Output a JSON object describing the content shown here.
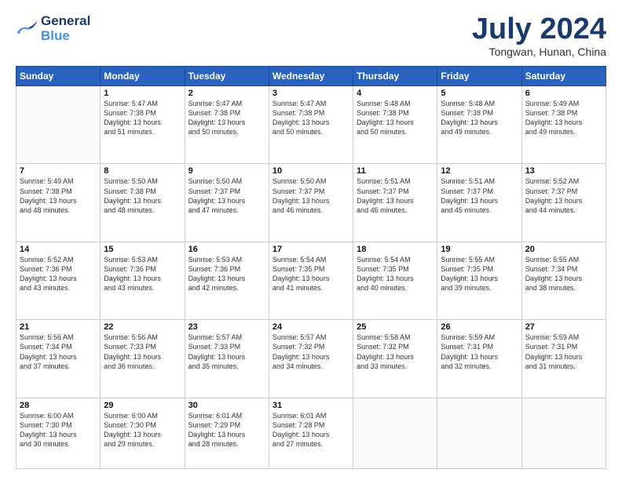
{
  "header": {
    "logo_line1": "General",
    "logo_line2": "Blue",
    "month": "July 2024",
    "location": "Tongwan, Hunan, China"
  },
  "days_of_week": [
    "Sunday",
    "Monday",
    "Tuesday",
    "Wednesday",
    "Thursday",
    "Friday",
    "Saturday"
  ],
  "weeks": [
    [
      {
        "day": "",
        "content": ""
      },
      {
        "day": "1",
        "content": "Sunrise: 5:47 AM\nSunset: 7:38 PM\nDaylight: 13 hours\nand 51 minutes."
      },
      {
        "day": "2",
        "content": "Sunrise: 5:47 AM\nSunset: 7:38 PM\nDaylight: 13 hours\nand 50 minutes."
      },
      {
        "day": "3",
        "content": "Sunrise: 5:47 AM\nSunset: 7:38 PM\nDaylight: 13 hours\nand 50 minutes."
      },
      {
        "day": "4",
        "content": "Sunrise: 5:48 AM\nSunset: 7:38 PM\nDaylight: 13 hours\nand 50 minutes."
      },
      {
        "day": "5",
        "content": "Sunrise: 5:48 AM\nSunset: 7:38 PM\nDaylight: 13 hours\nand 49 minutes."
      },
      {
        "day": "6",
        "content": "Sunrise: 5:49 AM\nSunset: 7:38 PM\nDaylight: 13 hours\nand 49 minutes."
      }
    ],
    [
      {
        "day": "7",
        "content": "Sunrise: 5:49 AM\nSunset: 7:38 PM\nDaylight: 13 hours\nand 48 minutes."
      },
      {
        "day": "8",
        "content": "Sunrise: 5:50 AM\nSunset: 7:38 PM\nDaylight: 13 hours\nand 48 minutes."
      },
      {
        "day": "9",
        "content": "Sunrise: 5:50 AM\nSunset: 7:37 PM\nDaylight: 13 hours\nand 47 minutes."
      },
      {
        "day": "10",
        "content": "Sunrise: 5:50 AM\nSunset: 7:37 PM\nDaylight: 13 hours\nand 46 minutes."
      },
      {
        "day": "11",
        "content": "Sunrise: 5:51 AM\nSunset: 7:37 PM\nDaylight: 13 hours\nand 46 minutes."
      },
      {
        "day": "12",
        "content": "Sunrise: 5:51 AM\nSunset: 7:37 PM\nDaylight: 13 hours\nand 45 minutes."
      },
      {
        "day": "13",
        "content": "Sunrise: 5:52 AM\nSunset: 7:37 PM\nDaylight: 13 hours\nand 44 minutes."
      }
    ],
    [
      {
        "day": "14",
        "content": "Sunrise: 5:52 AM\nSunset: 7:36 PM\nDaylight: 13 hours\nand 43 minutes."
      },
      {
        "day": "15",
        "content": "Sunrise: 5:53 AM\nSunset: 7:36 PM\nDaylight: 13 hours\nand 43 minutes."
      },
      {
        "day": "16",
        "content": "Sunrise: 5:53 AM\nSunset: 7:36 PM\nDaylight: 13 hours\nand 42 minutes."
      },
      {
        "day": "17",
        "content": "Sunrise: 5:54 AM\nSunset: 7:35 PM\nDaylight: 13 hours\nand 41 minutes."
      },
      {
        "day": "18",
        "content": "Sunrise: 5:54 AM\nSunset: 7:35 PM\nDaylight: 13 hours\nand 40 minutes."
      },
      {
        "day": "19",
        "content": "Sunrise: 5:55 AM\nSunset: 7:35 PM\nDaylight: 13 hours\nand 39 minutes."
      },
      {
        "day": "20",
        "content": "Sunrise: 5:55 AM\nSunset: 7:34 PM\nDaylight: 13 hours\nand 38 minutes."
      }
    ],
    [
      {
        "day": "21",
        "content": "Sunrise: 5:56 AM\nSunset: 7:34 PM\nDaylight: 13 hours\nand 37 minutes."
      },
      {
        "day": "22",
        "content": "Sunrise: 5:56 AM\nSunset: 7:33 PM\nDaylight: 13 hours\nand 36 minutes."
      },
      {
        "day": "23",
        "content": "Sunrise: 5:57 AM\nSunset: 7:33 PM\nDaylight: 13 hours\nand 35 minutes."
      },
      {
        "day": "24",
        "content": "Sunrise: 5:57 AM\nSunset: 7:32 PM\nDaylight: 13 hours\nand 34 minutes."
      },
      {
        "day": "25",
        "content": "Sunrise: 5:58 AM\nSunset: 7:32 PM\nDaylight: 13 hours\nand 33 minutes."
      },
      {
        "day": "26",
        "content": "Sunrise: 5:59 AM\nSunset: 7:31 PM\nDaylight: 13 hours\nand 32 minutes."
      },
      {
        "day": "27",
        "content": "Sunrise: 5:59 AM\nSunset: 7:31 PM\nDaylight: 13 hours\nand 31 minutes."
      }
    ],
    [
      {
        "day": "28",
        "content": "Sunrise: 6:00 AM\nSunset: 7:30 PM\nDaylight: 13 hours\nand 30 minutes."
      },
      {
        "day": "29",
        "content": "Sunrise: 6:00 AM\nSunset: 7:30 PM\nDaylight: 13 hours\nand 29 minutes."
      },
      {
        "day": "30",
        "content": "Sunrise: 6:01 AM\nSunset: 7:29 PM\nDaylight: 13 hours\nand 28 minutes."
      },
      {
        "day": "31",
        "content": "Sunrise: 6:01 AM\nSunset: 7:28 PM\nDaylight: 13 hours\nand 27 minutes."
      },
      {
        "day": "",
        "content": ""
      },
      {
        "day": "",
        "content": ""
      },
      {
        "day": "",
        "content": ""
      }
    ]
  ]
}
